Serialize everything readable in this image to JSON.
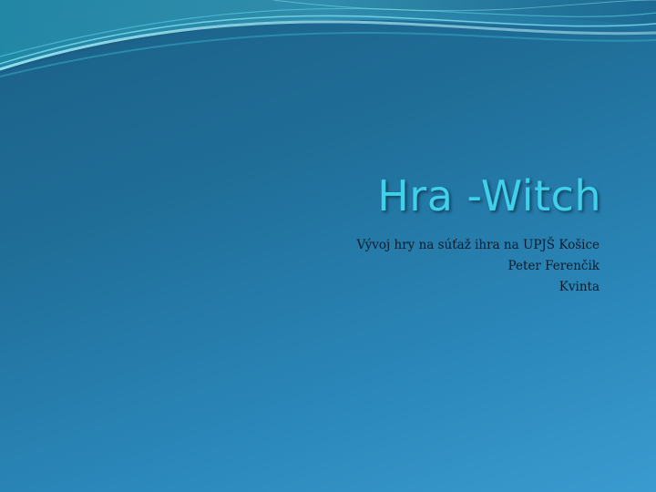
{
  "slide": {
    "title": "Hra -Witch",
    "subtitle_lines": [
      "Vývoj hry na súťaž ihra na UPJŠ Košice",
      "Peter Ferenčik",
      "Kvinta"
    ]
  },
  "colors": {
    "background_dark": "#1b5f86",
    "background_light": "#3a9bd0",
    "title": "#3fd0ea",
    "subtitle": "#0c1c2a",
    "wave_light": "#7fe0f0",
    "wave_teal": "#2ab0c8"
  },
  "icons": {
    "decoration": "wave-decoration"
  }
}
